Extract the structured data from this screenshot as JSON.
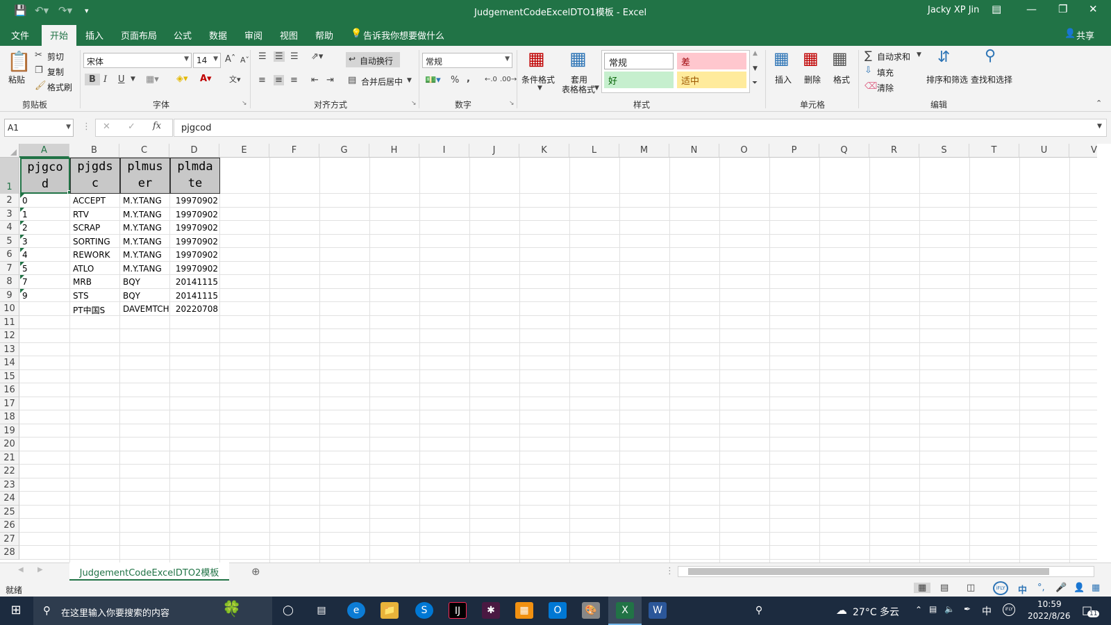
{
  "window": {
    "title": "JudgementCodeExcelDTO1模板  -  Excel",
    "user": "Jacky XP Jin"
  },
  "ribbon_tabs": [
    "文件",
    "开始",
    "插入",
    "页面布局",
    "公式",
    "数据",
    "审阅",
    "视图",
    "帮助"
  ],
  "tell_me": "告诉我你想要做什么",
  "share": "共享",
  "clipboard": {
    "paste": "粘贴",
    "cut": "剪切",
    "copy": "复制",
    "format_painter": "格式刷",
    "group": "剪贴板"
  },
  "font": {
    "name": "宋体",
    "size": "14",
    "group": "字体"
  },
  "alignment": {
    "wrap": "自动换行",
    "merge": "合并后居中",
    "group": "对齐方式"
  },
  "number": {
    "format": "常规",
    "group": "数字"
  },
  "styles": {
    "conditional": "条件格式",
    "table_line1": "套用",
    "table_line2": "表格格式",
    "normal": "常规",
    "bad": "差",
    "good": "好",
    "neutral": "适中",
    "group": "样式"
  },
  "cells": {
    "insert": "插入",
    "delete": "删除",
    "format": "格式",
    "group": "单元格"
  },
  "editing": {
    "autosum": "自动求和",
    "fill": "填充",
    "clear": "清除",
    "sort": "排序和筛选",
    "find": "查找和选择",
    "group": "编辑"
  },
  "name_box": "A1",
  "formula": "pjgcod",
  "columns": [
    "A",
    "B",
    "C",
    "D",
    "E",
    "F",
    "G",
    "H",
    "I",
    "J",
    "K",
    "L",
    "M",
    "N",
    "O",
    "P",
    "Q",
    "R",
    "S",
    "T",
    "U",
    "V"
  ],
  "header_cells": [
    {
      "l1": "pjgco",
      "l2": "d"
    },
    {
      "l1": "pjgds",
      "l2": "c"
    },
    {
      "l1": "plmus",
      "l2": "er"
    },
    {
      "l1": "plmda",
      "l2": "te"
    }
  ],
  "rows": [
    {
      "a": "0",
      "b": "ACCEPT",
      "c": "M.Y.TANG",
      "d": "19970902"
    },
    {
      "a": "1",
      "b": "RTV",
      "c": "M.Y.TANG",
      "d": "19970902"
    },
    {
      "a": "2",
      "b": "SCRAP",
      "c": "M.Y.TANG",
      "d": "19970902"
    },
    {
      "a": "3",
      "b": "SORTING",
      "c": "M.Y.TANG",
      "d": "19970902"
    },
    {
      "a": "4",
      "b": "REWORK",
      "c": "M.Y.TANG",
      "d": "19970902"
    },
    {
      "a": "5",
      "b": "ATLO",
      "c": "M.Y.TANG",
      "d": "19970902"
    },
    {
      "a": "7",
      "b": "MRB",
      "c": "BQY",
      "d": "20141115"
    },
    {
      "a": "9",
      "b": "STS",
      "c": "BQY",
      "d": "20141115"
    },
    {
      "a": "",
      "b": "PT中国S",
      "c": "DAVEMTCH",
      "d": "20220708"
    }
  ],
  "row_numbers": [
    "1",
    "2",
    "3",
    "4",
    "5",
    "6",
    "7",
    "8",
    "9",
    "10",
    "11",
    "12",
    "13",
    "14",
    "15",
    "16",
    "17",
    "18",
    "19",
    "20",
    "21",
    "22",
    "23",
    "24",
    "25",
    "26",
    "27",
    "28"
  ],
  "sheet_tab": "JudgementCodeExcelDTO2模板",
  "status": "就绪",
  "taskbar": {
    "search_placeholder": "在这里输入你要搜索的内容",
    "weather": "27°C  多云",
    "ime": "中",
    "time": "10:59",
    "date": "2022/8/26",
    "notifications": "11"
  }
}
